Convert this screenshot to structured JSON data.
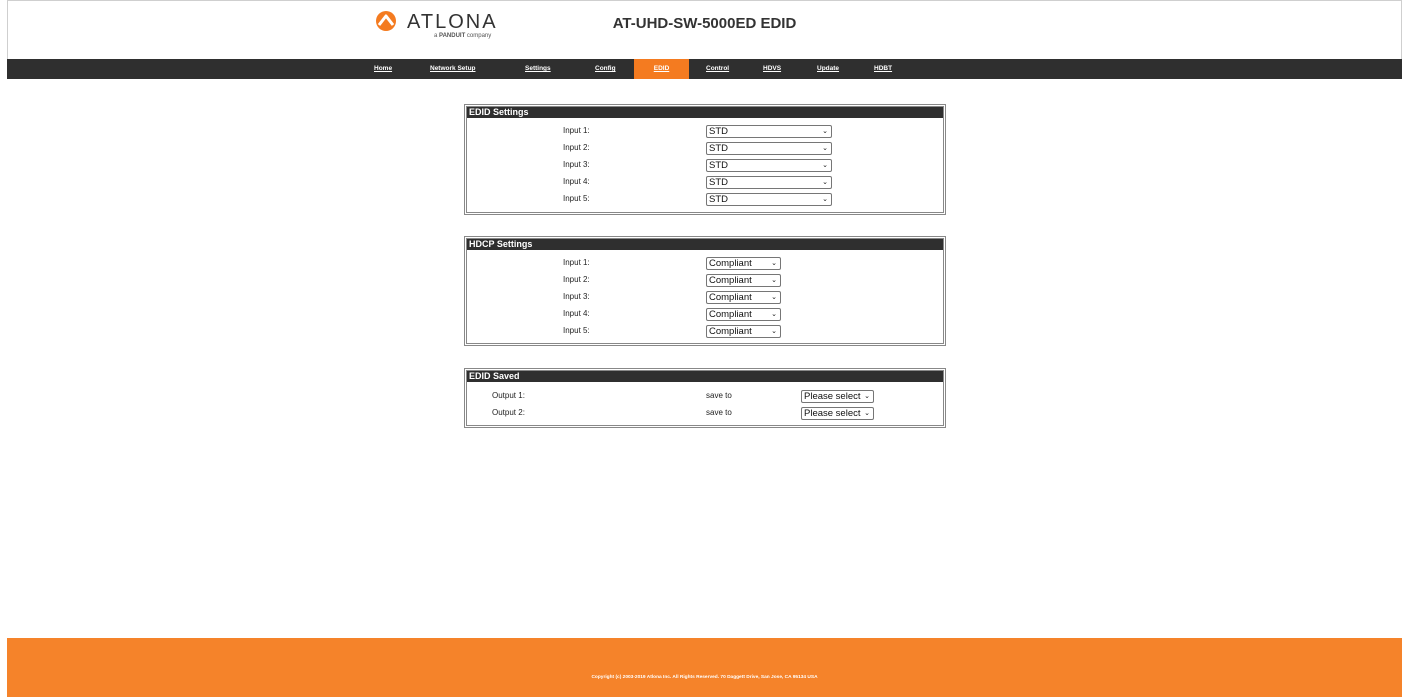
{
  "header": {
    "logo_text": "ATLONA",
    "logo_sub_prefix": "a",
    "logo_sub_brand": "PANDUIT",
    "logo_sub_suffix": "company",
    "title": "AT-UHD-SW-5000ED EDID"
  },
  "nav": {
    "items": [
      {
        "label": "Home"
      },
      {
        "label": "Network Setup"
      },
      {
        "label": "Settings"
      },
      {
        "label": "Config"
      },
      {
        "label": "EDID"
      },
      {
        "label": "Control"
      },
      {
        "label": "HDVS"
      },
      {
        "label": "Update"
      },
      {
        "label": "HDBT"
      }
    ],
    "active": "EDID",
    "active_color": "#f47b20",
    "bar_color": "#2f2f2f"
  },
  "edid_settings": {
    "title": "EDID Settings",
    "rows": [
      {
        "label": "Input 1:",
        "value": "STD"
      },
      {
        "label": "Input 2:",
        "value": "STD"
      },
      {
        "label": "Input 3:",
        "value": "STD"
      },
      {
        "label": "Input 4:",
        "value": "STD"
      },
      {
        "label": "Input 5:",
        "value": "STD"
      }
    ]
  },
  "hdcp_settings": {
    "title": "HDCP Settings",
    "rows": [
      {
        "label": "Input 1:",
        "value": "Compliant"
      },
      {
        "label": "Input 2:",
        "value": "Compliant"
      },
      {
        "label": "Input 3:",
        "value": "Compliant"
      },
      {
        "label": "Input 4:",
        "value": "Compliant"
      },
      {
        "label": "Input 5:",
        "value": "Compliant"
      }
    ]
  },
  "edid_saved": {
    "title": "EDID Saved",
    "rows": [
      {
        "label": "Output 1:",
        "save_to": "save to",
        "value": "Please select"
      },
      {
        "label": "Output 2:",
        "save_to": "save to",
        "value": "Please select"
      }
    ]
  },
  "footer": {
    "text": "Copyright (c) 2003-2019 Atlona Inc. All Rights Reserved. 70 Daggett Drive, San Jose, CA 95134 USA",
    "color": "#f5832a"
  },
  "icons": {
    "logo": "atlona-logo-icon",
    "dropdown": "chevron-down-icon"
  }
}
